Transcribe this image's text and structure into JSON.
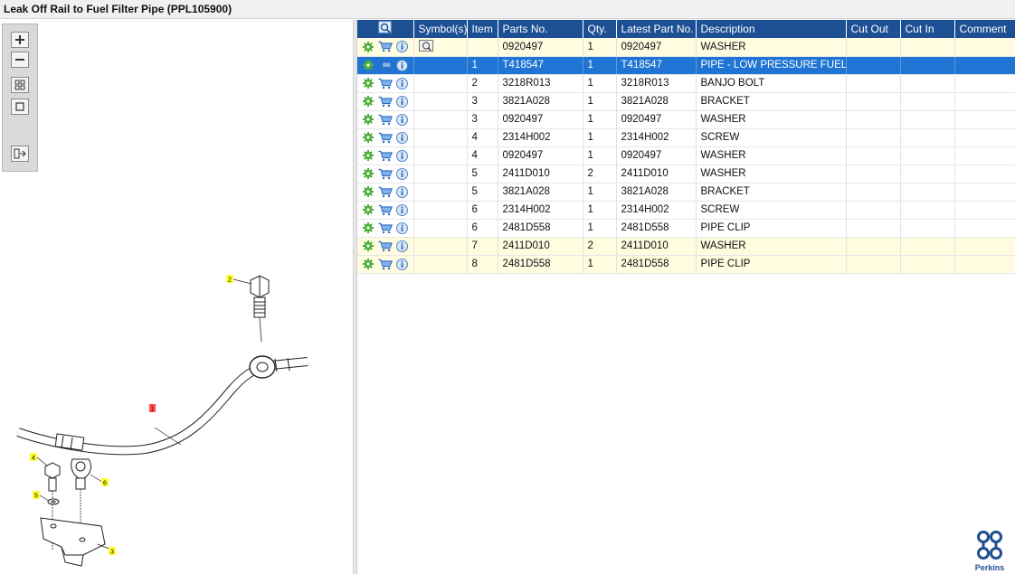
{
  "window": {
    "title": "Leak Off Rail to Fuel Filter Pipe (PPL105900)"
  },
  "toolbar": {
    "buttons": [
      "zoom-in",
      "zoom-out",
      "fit-all",
      "fit-window",
      "export"
    ]
  },
  "diagram": {
    "callouts": [
      "1",
      "2",
      "3",
      "4",
      "5",
      "6"
    ]
  },
  "table": {
    "columns": [
      "Symbol(s)",
      "Item",
      "Parts No.",
      "Qty.",
      "Latest Part No.",
      "Description",
      "Cut Out",
      "Cut In",
      "Comment"
    ],
    "rows": [
      {
        "item": "",
        "part": "0920497",
        "qty": "1",
        "latest": "0920497",
        "desc": "WASHER",
        "highlight": true,
        "selected": false,
        "symbol": "drawing-icon"
      },
      {
        "item": "1",
        "part": "T418547",
        "qty": "1",
        "latest": "T418547",
        "desc": "PIPE - LOW PRESSURE FUEL",
        "highlight": false,
        "selected": true,
        "symbol": ""
      },
      {
        "item": "2",
        "part": "3218R013",
        "qty": "1",
        "latest": "3218R013",
        "desc": "BANJO BOLT",
        "highlight": false,
        "selected": false,
        "symbol": ""
      },
      {
        "item": "3",
        "part": "3821A028",
        "qty": "1",
        "latest": "3821A028",
        "desc": "BRACKET",
        "highlight": false,
        "selected": false,
        "symbol": ""
      },
      {
        "item": "3",
        "part": "0920497",
        "qty": "1",
        "latest": "0920497",
        "desc": "WASHER",
        "highlight": false,
        "selected": false,
        "symbol": ""
      },
      {
        "item": "4",
        "part": "2314H002",
        "qty": "1",
        "latest": "2314H002",
        "desc": "SCREW",
        "highlight": false,
        "selected": false,
        "symbol": ""
      },
      {
        "item": "4",
        "part": "0920497",
        "qty": "1",
        "latest": "0920497",
        "desc": "WASHER",
        "highlight": false,
        "selected": false,
        "symbol": ""
      },
      {
        "item": "5",
        "part": "2411D010",
        "qty": "2",
        "latest": "2411D010",
        "desc": "WASHER",
        "highlight": false,
        "selected": false,
        "symbol": ""
      },
      {
        "item": "5",
        "part": "3821A028",
        "qty": "1",
        "latest": "3821A028",
        "desc": "BRACKET",
        "highlight": false,
        "selected": false,
        "symbol": ""
      },
      {
        "item": "6",
        "part": "2314H002",
        "qty": "1",
        "latest": "2314H002",
        "desc": "SCREW",
        "highlight": false,
        "selected": false,
        "symbol": ""
      },
      {
        "item": "6",
        "part": "2481D558",
        "qty": "1",
        "latest": "2481D558",
        "desc": "PIPE CLIP",
        "highlight": false,
        "selected": false,
        "symbol": ""
      },
      {
        "item": "7",
        "part": "2411D010",
        "qty": "2",
        "latest": "2411D010",
        "desc": "WASHER",
        "highlight": true,
        "selected": false,
        "symbol": ""
      },
      {
        "item": "8",
        "part": "2481D558",
        "qty": "1",
        "latest": "2481D558",
        "desc": "PIPE CLIP",
        "highlight": true,
        "selected": false,
        "symbol": ""
      }
    ]
  },
  "brand": {
    "name": "Perkins",
    "color": "#1d4f91"
  },
  "colors": {
    "header": "#1c4f94",
    "selected": "#1f74d4",
    "highlight": "#fffce0",
    "callout": "#ffff33",
    "callout_selected": "#ff4a4a"
  }
}
